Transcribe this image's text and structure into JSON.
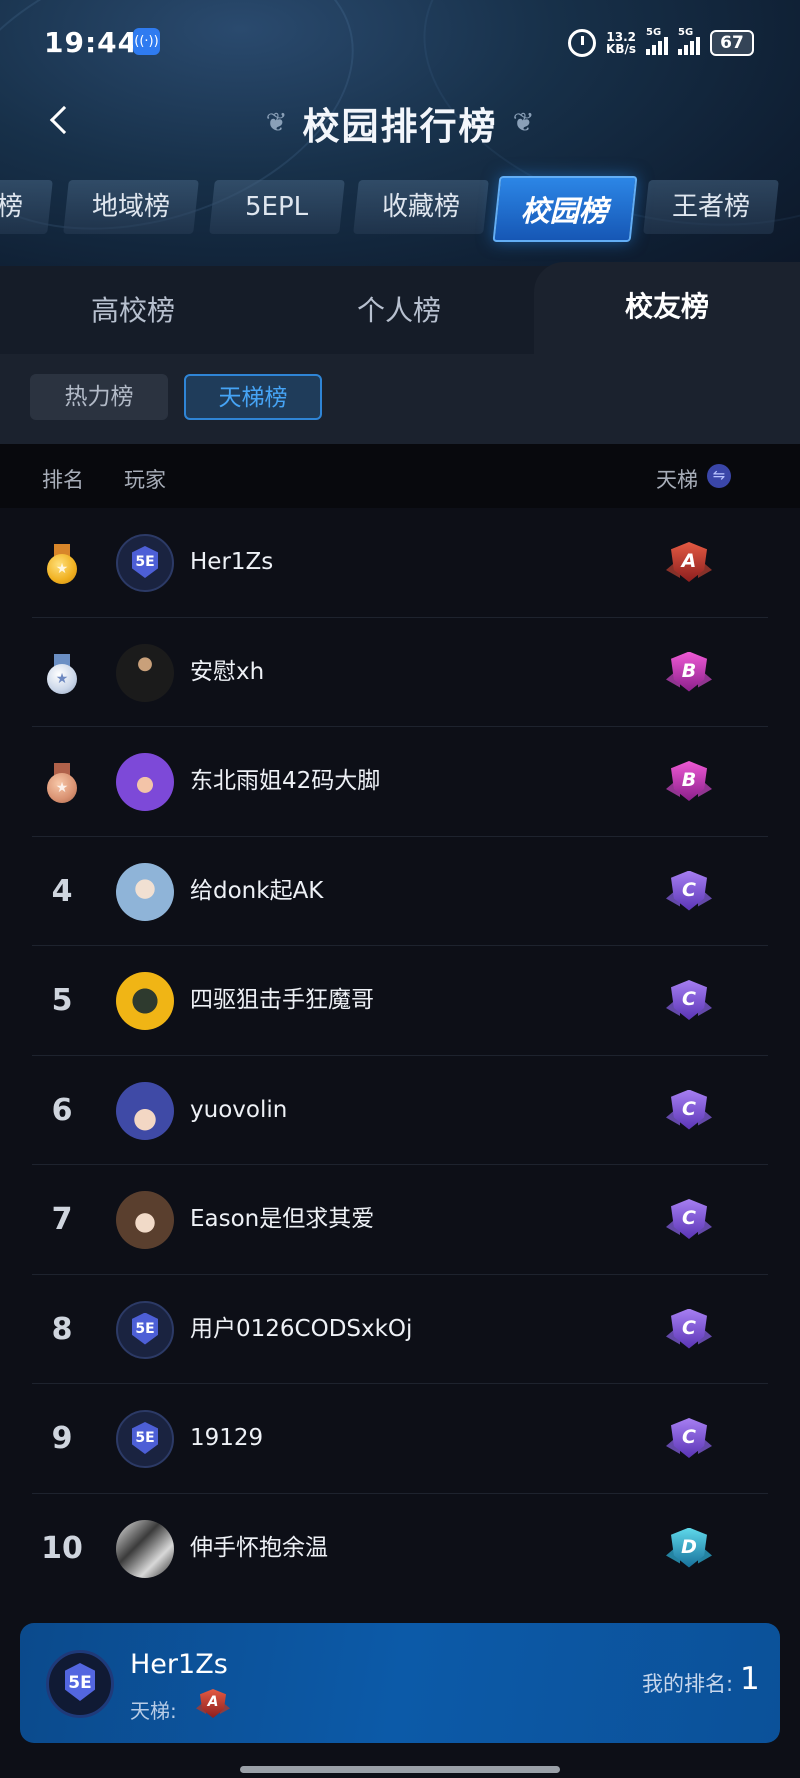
{
  "status_bar": {
    "time": "19:44",
    "speed_value": "13.2",
    "speed_unit": "KB/s",
    "signal1_label": "5G",
    "signal2_label": "5G",
    "battery": "67"
  },
  "header": {
    "title": "校园排行榜"
  },
  "category_tabs": [
    {
      "label": "榜",
      "active": false
    },
    {
      "label": "地域榜",
      "active": false
    },
    {
      "label": "5EPL",
      "active": false
    },
    {
      "label": "收藏榜",
      "active": false
    },
    {
      "label": "校园榜",
      "active": true
    },
    {
      "label": "王者榜",
      "active": false
    }
  ],
  "sub_tabs": [
    {
      "label": "高校榜",
      "active": false
    },
    {
      "label": "个人榜",
      "active": false
    },
    {
      "label": "校友榜",
      "active": true
    }
  ],
  "filters": [
    {
      "label": "热力榜",
      "active": false
    },
    {
      "label": "天梯榜",
      "active": true
    }
  ],
  "columns": {
    "rank": "排名",
    "player": "玩家",
    "ladder": "天梯"
  },
  "rows": [
    {
      "rank": "1",
      "medal": "gold",
      "avatar": "5e-logo",
      "name": "Her1Zs",
      "tier": "A"
    },
    {
      "rank": "2",
      "medal": "silver",
      "avatar": "photo",
      "name": "安慰xh",
      "tier": "B"
    },
    {
      "rank": "3",
      "medal": "bronze",
      "avatar": "purple-hero",
      "name": "东北雨姐42码大脚",
      "tier": "B"
    },
    {
      "rank": "4",
      "medal": "",
      "avatar": "anime-blue",
      "name": "给donk起AK",
      "tier": "C"
    },
    {
      "rank": "5",
      "medal": "",
      "avatar": "gasmask",
      "name": "四驱狙击手狂魔哥",
      "tier": "C"
    },
    {
      "rank": "6",
      "medal": "",
      "avatar": "batman",
      "name": "yuovolin",
      "tier": "C"
    },
    {
      "rank": "7",
      "medal": "",
      "avatar": "anime-brown",
      "name": "Eason是但求其爱",
      "tier": "C"
    },
    {
      "rank": "8",
      "medal": "",
      "avatar": "5e-logo",
      "name": "用户0126CODSxkOj",
      "tier": "C"
    },
    {
      "rank": "9",
      "medal": "",
      "avatar": "5e-logo",
      "name": "19129",
      "tier": "C"
    },
    {
      "rank": "10",
      "medal": "",
      "avatar": "bw-photo",
      "name": "伸手怀抱余温",
      "tier": "D"
    }
  ],
  "my_rank": {
    "name": "Her1Zs",
    "ladder_label": "天梯:",
    "tier": "A",
    "rank_label": "我的排名:",
    "rank_value": "1"
  },
  "colors": {
    "accent": "#1e6fd0",
    "filter_active": "#46a4f5",
    "background": "#0d0f17"
  },
  "icons": {
    "back": "chevron-left-icon",
    "swap": "swap-icon",
    "gold_medal": "gold-medal-icon",
    "silver_medal": "silver-medal-icon",
    "bronze_medal": "bronze-medal-icon"
  }
}
